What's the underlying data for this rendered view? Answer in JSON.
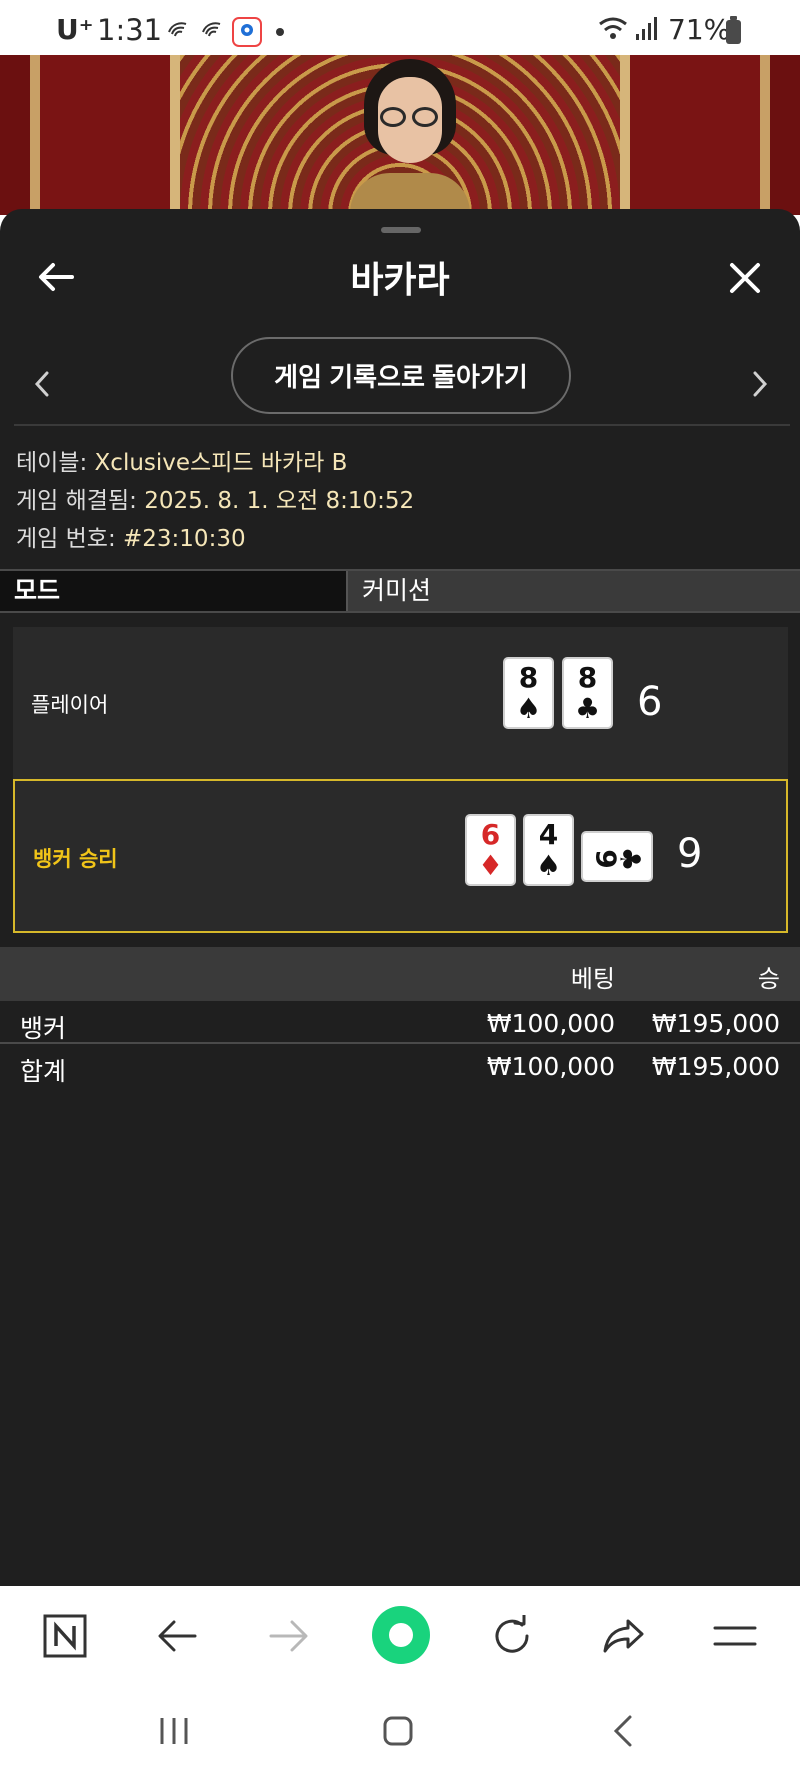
{
  "status_bar": {
    "carrier": "U⁺",
    "time": "1:31",
    "battery": "71%",
    "icons": [
      "notification-icon",
      "notification-icon",
      "location-icon",
      "wifi-icon",
      "signal-icon",
      "battery-icon"
    ]
  },
  "sheet": {
    "title": "바카라",
    "back_icon": "arrow-left-icon",
    "close_icon": "close-icon",
    "history_button": "게임 기록으로 돌아가기",
    "prev_icon": "chevron-left-icon",
    "next_icon": "chevron-right-icon"
  },
  "game_info": {
    "table_label": "테이블:",
    "table_value": "Xclusive스피드 바카라 B",
    "resolved_label": "게임 해결됨:",
    "resolved_value": "2025. 8. 1. 오전 8:10:52",
    "number_label": "게임 번호:",
    "number_value": "#23:10:30"
  },
  "mode": {
    "label": "모드",
    "value": "커미션"
  },
  "hands": {
    "player": {
      "label": "플레이어",
      "score": "6",
      "cards": [
        {
          "rank": "8",
          "suit": "♠",
          "color": "black"
        },
        {
          "rank": "8",
          "suit": "♣",
          "color": "black"
        }
      ]
    },
    "banker": {
      "label": "뱅커 승리",
      "score": "9",
      "cards": [
        {
          "rank": "6",
          "suit": "♦",
          "color": "red"
        },
        {
          "rank": "4",
          "suit": "♠",
          "color": "black"
        },
        {
          "rank": "9",
          "suit": "♣",
          "color": "black",
          "sideways": true
        }
      ]
    }
  },
  "bets": {
    "header_bet": "베팅",
    "header_win": "승",
    "rows": [
      {
        "name": "뱅커",
        "bet": "₩100,000",
        "win": "₩195,000"
      },
      {
        "name": "합계",
        "bet": "₩100,000",
        "win": "₩195,000"
      }
    ]
  },
  "colors": {
    "sheet_bg": "#1f1f1f",
    "panel_bg": "#2a2a2a",
    "winner_border": "#d6b82a",
    "winner_text": "#f0c419",
    "info_value": "#f5e6b8",
    "accent_green": "#19d37d"
  },
  "browser_toolbar": [
    "home-n-icon",
    "back-arrow-icon",
    "forward-arrow-icon",
    "center-circle-icon",
    "reload-icon",
    "share-icon",
    "menu-icon"
  ],
  "system_nav": [
    "recent-apps-icon",
    "home-icon",
    "back-icon"
  ]
}
